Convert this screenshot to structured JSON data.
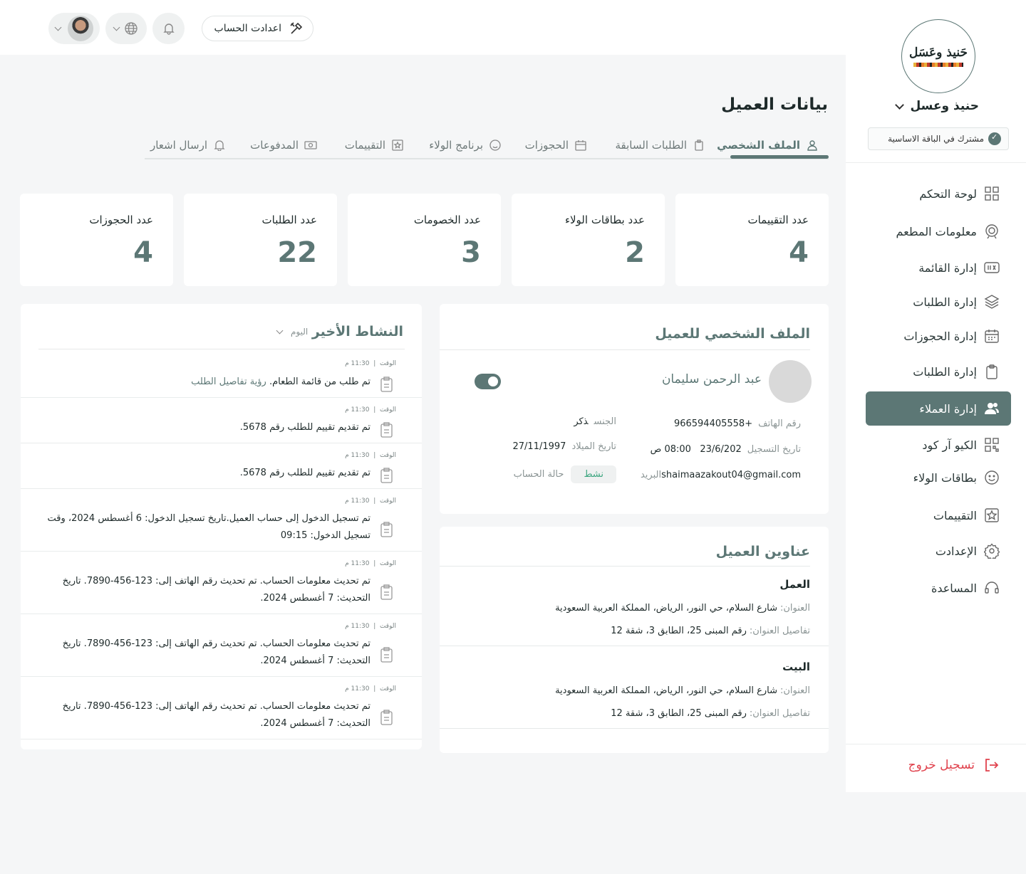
{
  "topbar": {
    "account_settings": "اعدادت الحساب"
  },
  "sidebar": {
    "logo_text": "حَنيذ وعَسَل",
    "brand": "حنيذ وعسل",
    "plan": "مشترك في الباقة الاساسية",
    "items": [
      {
        "label": "لوحة التحكم",
        "icon": "grid-icon"
      },
      {
        "label": "معلومات المطعم",
        "icon": "restaurant-icon"
      },
      {
        "label": "إدارة القائمة",
        "icon": "menu-icon"
      },
      {
        "label": "إدارة الطلبات",
        "icon": "layers-icon"
      },
      {
        "label": "إدارة الحجوزات",
        "icon": "calendar-icon"
      },
      {
        "label": "إدارة الطلبات",
        "icon": "clipboard-icon"
      },
      {
        "label": "إدارة العملاء",
        "icon": "users-icon"
      },
      {
        "label": "الكيو آر كود",
        "icon": "qr-icon"
      },
      {
        "label": "بطاقات الولاء",
        "icon": "smile-icon"
      },
      {
        "label": "التقييمات",
        "icon": "star-icon"
      },
      {
        "label": "الإعدادت",
        "icon": "gear-icon"
      },
      {
        "label": "المساعدة",
        "icon": "headset-icon"
      }
    ],
    "logout": "تسجيل خروج"
  },
  "page": {
    "title": "بيانات العميل",
    "tabs": [
      {
        "label": "الملف الشخصي",
        "icon": "user-icon"
      },
      {
        "label": "الطلبات السابقة",
        "icon": "clipboard-icon"
      },
      {
        "label": "الحجوزات",
        "icon": "calendar-icon"
      },
      {
        "label": "برنامج الولاء",
        "icon": "smile-icon"
      },
      {
        "label": "التقييمات",
        "icon": "star-icon"
      },
      {
        "label": "المدفوعات",
        "icon": "cash-icon"
      },
      {
        "label": "ارسال اشعار",
        "icon": "bell-icon"
      }
    ]
  },
  "stats": [
    {
      "label": "عدد التقييمات",
      "value": "4"
    },
    {
      "label": "عدد بطاقات الولاء",
      "value": "2"
    },
    {
      "label": "عدد الخصومات",
      "value": "3"
    },
    {
      "label": "عدد الطلبات",
      "value": "22"
    },
    {
      "label": "عدد الحجوزات",
      "value": "4"
    }
  ],
  "profile": {
    "title": "الملف الشخصي للعميل",
    "name": "عبد الرحمن سليمان",
    "phone_label": "رقم الهاتف",
    "phone": "+966594405558",
    "gender_label": "الجنس",
    "gender": "ذكر",
    "reg_label": "تاريخ التسجيل",
    "reg_date": "23/6/202",
    "reg_time": "08:00 ص",
    "dob_label": "تاريخ الميلاد",
    "dob": "27/11/1997",
    "email_label": "البريد",
    "email": "shaimaazakout04@gmail.com",
    "status_label": "حالة الحساب",
    "status": "نشط",
    "active": true
  },
  "addresses": {
    "title": "عناوين العميل",
    "address_label": "العنوان:",
    "details_label": "تفاصيل العنوان:",
    "items": [
      {
        "name": "العمل",
        "address": "شارع السلام، حي النور، الرياض، المملكة العربية السعودية",
        "details": "رقم المبنى 25، الطابق 3، شقة 12"
      },
      {
        "name": "البيت",
        "address": "شارع السلام، حي النور، الرياض، المملكة العربية السعودية",
        "details": "رقم المبنى 25، الطابق 3، شقة 12"
      }
    ]
  },
  "activity": {
    "title": "النشاط الأخير",
    "filter": "اليوم",
    "time_label": "الوقت",
    "items": [
      {
        "time": "11:30 م",
        "text": "تم طلب من قائمة الطعام.",
        "link": "رؤية تفاصيل الطلب"
      },
      {
        "time": "11:30 م",
        "text": "تم تقديم تقييم للطلب رقم 5678."
      },
      {
        "time": "11:30 م",
        "text": "تم تقديم تقييم للطلب رقم 5678."
      },
      {
        "time": "11:30 م",
        "text": "تم تسجيل الدخول إلى حساب العميل.تاريخ تسجيل الدخول: 6 أغسطس 2024، وقت تسجيل الدخول: 09:15"
      },
      {
        "time": "11:30 م",
        "text": "تم تحديث معلومات الحساب. تم تحديث رقم الهاتف إلى: 123-456-7890. تاريخ التحديث: 7 أغسطس 2024."
      },
      {
        "time": "11:30 م",
        "text": "تم تحديث معلومات الحساب. تم تحديث رقم الهاتف إلى: 123-456-7890. تاريخ التحديث: 7 أغسطس 2024."
      },
      {
        "time": "11:30 م",
        "text": "تم تحديث معلومات الحساب. تم تحديث رقم الهاتف إلى: 123-456-7890. تاريخ التحديث: 7 أغسطس 2024."
      }
    ]
  },
  "colors": {
    "accent": "#5c7775",
    "logout": "#e0424d",
    "status_ok": "#3aa57e"
  }
}
